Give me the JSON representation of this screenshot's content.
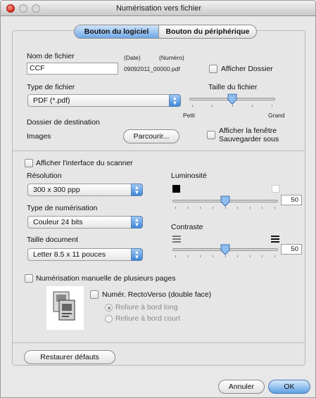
{
  "window": {
    "title": "Numérisation vers fichier"
  },
  "tabs": [
    {
      "label": "Bouton du logiciel",
      "selected": true
    },
    {
      "label": "Bouton du périphérique",
      "selected": false
    }
  ],
  "file_name": {
    "label": "Nom de fichier",
    "value": "CCF",
    "date_caption": "(Date)",
    "number_caption": "(Numéro)",
    "generated_name": "09092011_00000.pdf",
    "show_folder_label": "Afficher Dossier",
    "show_folder_checked": false
  },
  "file_type": {
    "label": "Type de fichier",
    "value": "PDF (*.pdf)"
  },
  "file_size": {
    "label": "Taille du fichier",
    "min_label": "Petit",
    "max_label": "Grand",
    "level": 0.5
  },
  "destination": {
    "label": "Dossier de destination",
    "value": "Images",
    "browse_label": "Parcourir...",
    "save_as_label_line1": "Afficher la fenêtre",
    "save_as_label_line2": "Sauvegarder sous",
    "save_as_checked": false
  },
  "scanner": {
    "show_interface_label": "Afficher l'interface du scanner",
    "show_interface_checked": false,
    "resolution_label": "Résolution",
    "resolution_value": "300 x 300 ppp",
    "scan_type_label": "Type de numérisation",
    "scan_type_value": "Couleur 24 bits",
    "doc_size_label": "Taille document",
    "doc_size_value": "Letter  8.5 x 11 pouces",
    "brightness_label": "Luminosité",
    "brightness_value": "50",
    "contrast_label": "Contraste",
    "contrast_value": "50"
  },
  "multipage": {
    "label": "Numérisation manuelle de plusieurs pages",
    "checked": false,
    "duplex_label": "Numér. RectoVerso (double face)",
    "duplex_checked": false,
    "long_edge_label": "Reliure à bord long",
    "long_edge_selected": true,
    "short_edge_label": "Reliure à bord court",
    "short_edge_selected": false
  },
  "footer": {
    "restore_label": "Restaurer défauts",
    "cancel_label": "Annuler",
    "ok_label": "OK"
  },
  "colors": {
    "accent": "#5ea0e6",
    "close_button": "#d4281b"
  }
}
